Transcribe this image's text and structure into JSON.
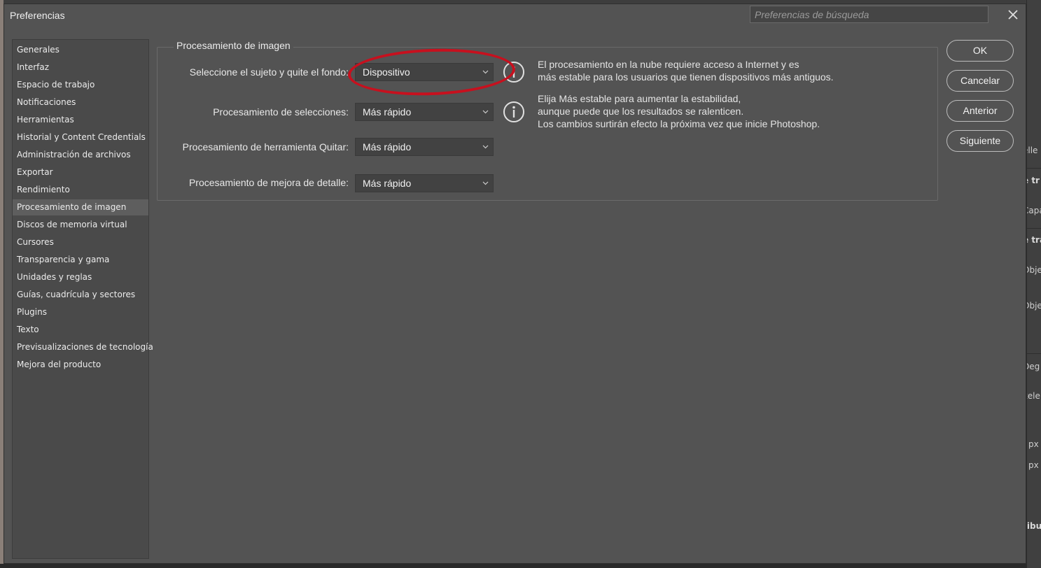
{
  "dialog": {
    "title": "Preferencias",
    "search_placeholder": "Preferencias de búsqueda"
  },
  "sidebar": {
    "items": [
      {
        "label": "Generales"
      },
      {
        "label": "Interfaz"
      },
      {
        "label": "Espacio de trabajo"
      },
      {
        "label": "Notificaciones"
      },
      {
        "label": "Herramientas"
      },
      {
        "label": "Historial y Content Credentials"
      },
      {
        "label": "Administración de archivos"
      },
      {
        "label": "Exportar"
      },
      {
        "label": "Rendimiento"
      },
      {
        "label": "Procesamiento de imagen",
        "selected": true
      },
      {
        "label": "Discos de memoria virtual"
      },
      {
        "label": "Cursores"
      },
      {
        "label": "Transparencia y gama"
      },
      {
        "label": "Unidades y reglas"
      },
      {
        "label": "Guías, cuadrícula y sectores"
      },
      {
        "label": "Plugins"
      },
      {
        "label": "Texto"
      },
      {
        "label": "Previsualizaciones de tecnología"
      },
      {
        "label": "Mejora del producto"
      }
    ]
  },
  "main": {
    "group_title": "Procesamiento de imagen",
    "rows": [
      {
        "label": "Seleccione el sujeto y quite el fondo:",
        "value": "Dispositivo"
      },
      {
        "label": "Procesamiento de selecciones:",
        "value": "Más rápido"
      },
      {
        "label": "Procesamiento de herramienta Quitar:",
        "value": "Más rápido"
      },
      {
        "label": "Procesamiento de mejora de detalle:",
        "value": "Más rápido"
      }
    ],
    "info1": {
      "line1": "El procesamiento en la nube requiere acceso a Internet y es",
      "line2": "más estable para los usuarios que tienen dispositivos más antiguos."
    },
    "info2": {
      "line1": "Elija Más estable para aumentar la estabilidad,",
      "line2": "aunque puede que los resultados se ralenticen.",
      "line3": "Los cambios surtirán efecto la próxima vez que inicie Photoshop."
    },
    "annotation_color": "#c7101e"
  },
  "buttons": {
    "ok": "OK",
    "cancel": "Cancelar",
    "previous": "Anterior",
    "next": "Siguiente"
  },
  "background": {
    "right_fragments": [
      "elle",
      "e tr",
      "Capa",
      "e tra",
      "Obje",
      "Obje",
      "Deg",
      "xele",
      "px",
      "px",
      "ribu"
    ]
  }
}
